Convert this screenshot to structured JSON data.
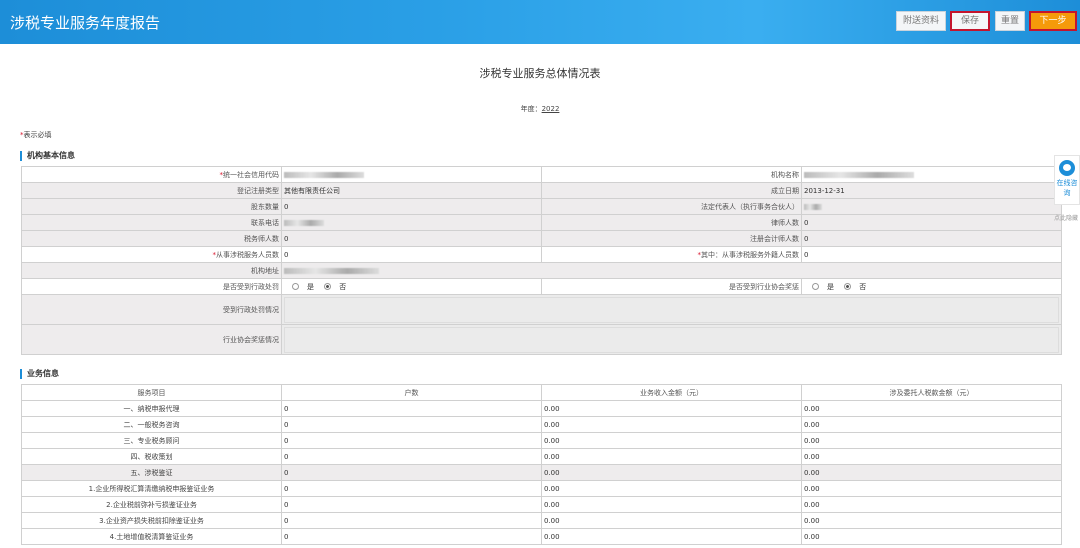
{
  "header": {
    "title": "涉税专业服务年度报告",
    "buttons": {
      "attach": "附送资料",
      "save": "保存",
      "reset": "重置",
      "next": "下一步"
    }
  },
  "doc": {
    "title": "涉税专业服务总体情况表",
    "year_label": "年度：",
    "year_value": "2022",
    "required_mark": "*",
    "required_note": "表示必填"
  },
  "org_section": {
    "heading": "机构基本信息",
    "fields": {
      "credit_code": "统一社会信用代码",
      "org_name": "机构名称",
      "reg_type": "登记注册类型",
      "reg_type_value": "其他有限责任公司",
      "founded": "成立日期",
      "founded_value": "2013-12-31",
      "shareholders": "股东数量",
      "shareholders_value": "0",
      "legal_rep": "法定代表人（执行事务合伙人）",
      "phone": "联系电话",
      "lawyers": "律师人数",
      "lawyers_value": "0",
      "tax_agents": "税务师人数",
      "tax_agents_value": "0",
      "accountants": "注册会计师人数",
      "accountants_value": "0",
      "staff": "从事涉税服务人员数",
      "staff_value": "0",
      "foreign_staff": "其中：从事涉税服务外籍人员数",
      "foreign_staff_value": "0",
      "address": "机构地址",
      "penalty_q": "是否受到行政处罚",
      "award_q": "是否受到行业协会奖惩",
      "yes": "是",
      "no": "否",
      "penalty_detail": "受到行政处罚情况",
      "award_detail": "行业协会奖惩情况"
    }
  },
  "biz_section": {
    "heading": "业务信息",
    "columns": [
      "服务项目",
      "户数",
      "业务收入金额（元）",
      "涉及委托人税款金额（元）"
    ],
    "rows": [
      {
        "item": "一、纳税申报代理",
        "households": "0",
        "income": "0.00",
        "tax": "0.00"
      },
      {
        "item": "二、一般税务咨询",
        "households": "0",
        "income": "0.00",
        "tax": "0.00"
      },
      {
        "item": "三、专业税务顾问",
        "households": "0",
        "income": "0.00",
        "tax": "0.00"
      },
      {
        "item": "四、税收策划",
        "households": "0",
        "income": "0.00",
        "tax": "0.00"
      },
      {
        "item": "五、涉税鉴证",
        "households": "0",
        "income": "0.00",
        "tax": "0.00"
      },
      {
        "item": "1.企业所得税汇算清缴纳税申报鉴证业务",
        "households": "0",
        "income": "0.00",
        "tax": "0.00"
      },
      {
        "item": "2.企业税前弥补亏损鉴证业务",
        "households": "0",
        "income": "0.00",
        "tax": "0.00"
      },
      {
        "item": "3.企业资产损失税前扣除鉴证业务",
        "households": "0",
        "income": "0.00",
        "tax": "0.00"
      },
      {
        "item": "4.土地增值税清算鉴证业务",
        "households": "0",
        "income": "0.00",
        "tax": "0.00"
      }
    ]
  },
  "side": {
    "consult": "在线咨询",
    "close": "点此隐藏"
  },
  "colors": {
    "header_blue": "#2a9fe6",
    "next_orange": "#f59a0a",
    "highlight_red": "#c4142d"
  }
}
